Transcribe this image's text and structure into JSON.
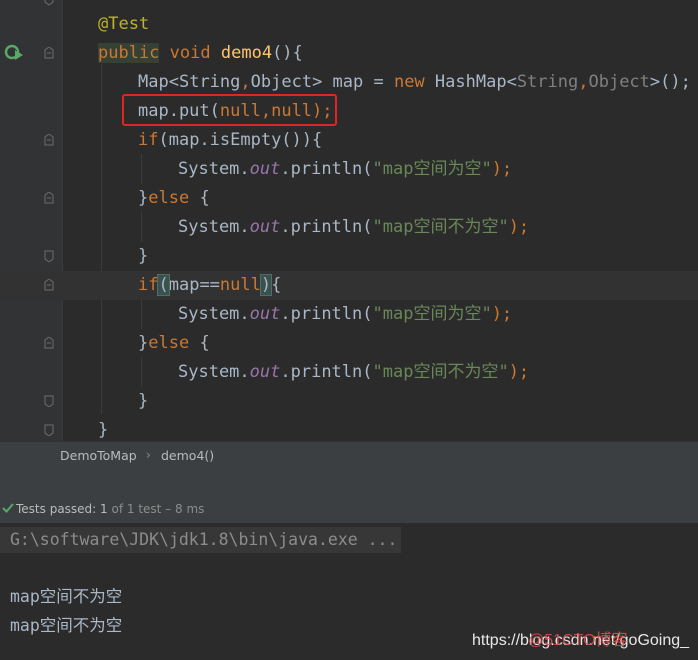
{
  "editor": {
    "lines": {
      "l0": {
        "annotation": "@Test"
      },
      "l1": {
        "public": "public",
        "void": "void",
        "method": "demo4",
        "rest": "(){"
      },
      "l2": {
        "a": "Map",
        "b": "<",
        "c": "String",
        "d": ",",
        "e": "Object",
        "f": "> map = ",
        "g": "new",
        "h": " HashMap",
        "i": "<",
        "j": "String",
        "k": ",",
        "l": "Object",
        "m": ">();"
      },
      "l3": {
        "a": "map.put(",
        "b": "null",
        "c": ",",
        "d": "null",
        "e": ");"
      },
      "l4": {
        "a": "if",
        "b": "(map.isEmpty()){"
      },
      "l5": {
        "a": "System.",
        "b": "out",
        "c": ".println(",
        "d": "\"map空间为空\"",
        "e": ");"
      },
      "l6": {
        "a": "}",
        "b": "else",
        "c": " {"
      },
      "l7": {
        "a": "System.",
        "b": "out",
        "c": ".println(",
        "d": "\"map空间不为空\"",
        "e": ");"
      },
      "l8": {
        "a": "}"
      },
      "l9": {
        "a": "if",
        "b": "(",
        "c": "map==",
        "d": "null",
        "e": ")",
        "f": "{"
      },
      "l10": {
        "a": "System.",
        "b": "out",
        "c": ".println(",
        "d": "\"map空间为空\"",
        "e": ");"
      },
      "l11": {
        "a": "}",
        "b": "else",
        "c": " {"
      },
      "l12": {
        "a": "System.",
        "b": "out",
        "c": ".println(",
        "d": "\"map空间不为空\"",
        "e": ");"
      },
      "l13": {
        "a": "}"
      },
      "l14": {
        "a": "}"
      }
    },
    "icons": {
      "run": "run-test-icon",
      "bulb": "intention-bulb-icon"
    },
    "colors": {
      "keyword": "#cc7832",
      "annotation": "#bbb529",
      "method": "#ffc66d",
      "string": "#6a8759",
      "field": "#9876aa",
      "highlight_box": "#e22424"
    }
  },
  "breadcrumb": {
    "class_name": "DemoToMap",
    "separator": "›",
    "method_name": "demo4()"
  },
  "run_panel": {
    "status_prefix": "Tests passed: ",
    "status_count": "1",
    "status_detail": " of 1 test – 8 ms",
    "console": {
      "command": "G:\\software\\JDK\\jdk1.8\\bin\\java.exe ...",
      "output": [
        "map空间不为空",
        "map空间不为空"
      ]
    }
  },
  "watermark": {
    "url": "https://blog.csdn.net/goGoing_",
    "overlay": "@51CTO博客"
  }
}
